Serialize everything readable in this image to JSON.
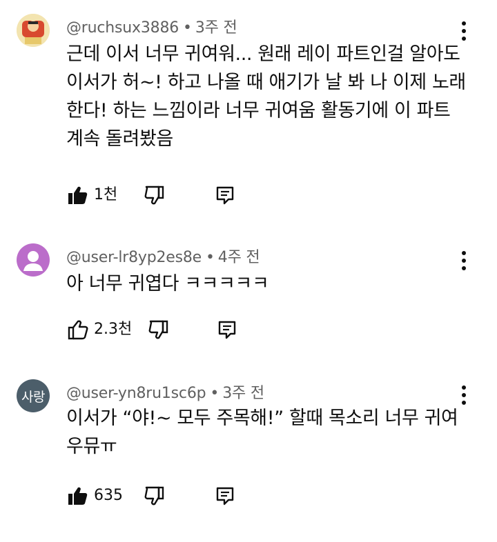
{
  "comments": [
    {
      "author": "@ruchsux3886",
      "separator": "•",
      "time": "3주 전",
      "text": "근데 이서 너무 귀여워... 원래 레이 파트인걸 알아도 이서가 허~! 하고 나올 때 애기가 날 봐 나 이제 노래한다! 하는 느낌이라 너무 귀여움 활동기에 이 파트 계속 돌려봤음",
      "likes": "1천",
      "avatar_type": "image",
      "liked": true
    },
    {
      "author": "@user-lr8yp2es8e",
      "separator": "•",
      "time": "4주 전",
      "text": "아 너무 귀엽다 ㅋㅋㅋㅋㅋ",
      "likes": "2.3천",
      "avatar_type": "default",
      "liked": false
    },
    {
      "author": "@user-yn8ru1sc6p",
      "separator": "•",
      "time": "3주 전",
      "text": "이서가 “야!~ 모두 주목해!” 할때 목소리 너무 귀여우뮤ㅠ",
      "likes": "635",
      "avatar_type": "text",
      "avatar_text": "사랑",
      "liked": true
    }
  ],
  "icons": {
    "like": "thumbs-up-icon",
    "dislike": "thumbs-down-icon",
    "reply": "reply-icon",
    "more": "more-vert-icon"
  },
  "colors": {
    "text": "#0f0f0f",
    "meta": "#606060",
    "avatar_default": "#bb6dca",
    "avatar_text_bg": "#4c5e6a"
  }
}
